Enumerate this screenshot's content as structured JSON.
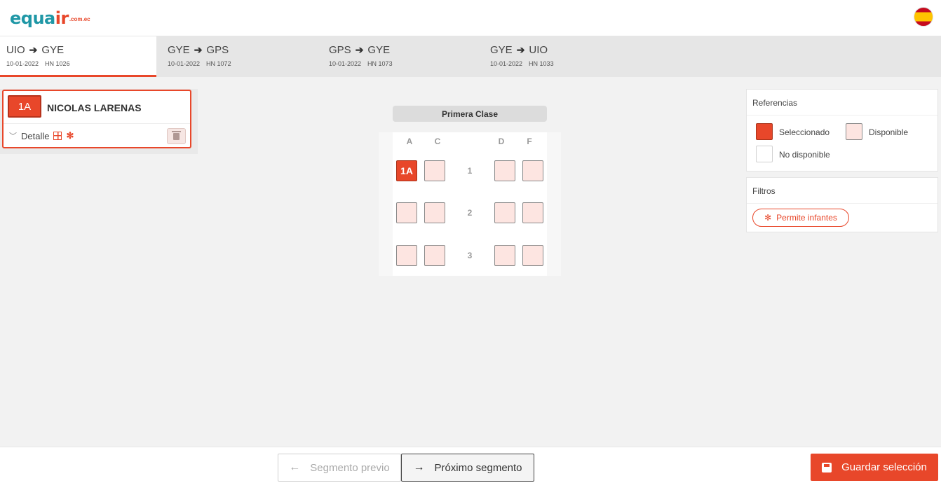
{
  "header": {
    "logo_main": "equa",
    "logo_accent": "ir",
    "logo_suffix": ".com.ec",
    "language_flag_icon": "spain-flag-icon"
  },
  "tabs": [
    {
      "from": "UIO",
      "to": "GYE",
      "date": "10-01-2022",
      "flight": "HN 1026",
      "active": true
    },
    {
      "from": "GYE",
      "to": "GPS",
      "date": "10-01-2022",
      "flight": "HN 1072",
      "active": false
    },
    {
      "from": "GPS",
      "to": "GYE",
      "date": "10-01-2022",
      "flight": "HN 1073",
      "active": false
    },
    {
      "from": "GYE",
      "to": "UIO",
      "date": "10-01-2022",
      "flight": "HN 1033",
      "active": false
    }
  ],
  "passenger": {
    "seat": "1A",
    "name": "NICOLAS LARENAS",
    "detail_label": "Detalle"
  },
  "seatmap": {
    "cabin": "Primera Clase",
    "columns": [
      "A",
      "C",
      "D",
      "F"
    ],
    "rows": [
      {
        "number": "1",
        "seats": [
          {
            "id": "1A",
            "status": "selected",
            "label": "1A"
          },
          {
            "id": "1C",
            "status": "available",
            "label": ""
          },
          {
            "id": "1D",
            "status": "available",
            "label": ""
          },
          {
            "id": "1F",
            "status": "available",
            "label": ""
          }
        ]
      },
      {
        "number": "2",
        "seats": [
          {
            "id": "2A",
            "status": "available",
            "label": ""
          },
          {
            "id": "2C",
            "status": "available",
            "label": ""
          },
          {
            "id": "2D",
            "status": "available",
            "label": ""
          },
          {
            "id": "2F",
            "status": "available",
            "label": ""
          }
        ]
      },
      {
        "number": "3",
        "seats": [
          {
            "id": "3A",
            "status": "available",
            "label": ""
          },
          {
            "id": "3C",
            "status": "available",
            "label": ""
          },
          {
            "id": "3D",
            "status": "available",
            "label": ""
          },
          {
            "id": "3F",
            "status": "available",
            "label": ""
          }
        ]
      }
    ]
  },
  "references": {
    "title": "Referencias",
    "selected": "Seleccionado",
    "available": "Disponible",
    "unavailable": "No disponible"
  },
  "filters": {
    "title": "Filtros",
    "infants_button": "Permite infantes"
  },
  "footer": {
    "prev_label": "Segmento previo",
    "next_label": "Próximo segmento",
    "save_label": "Guardar selección"
  },
  "colors": {
    "accent": "#e8472a",
    "available_seat": "#fde5e1",
    "teal": "#1f97a6"
  }
}
